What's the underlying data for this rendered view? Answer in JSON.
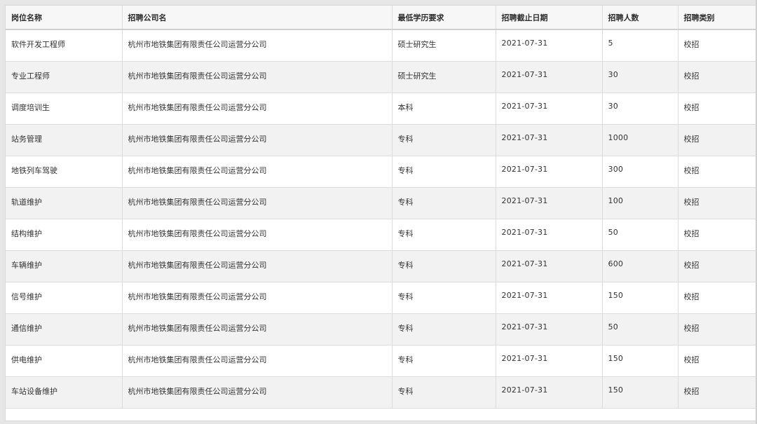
{
  "table": {
    "headers": [
      "岗位名称",
      "招聘公司名",
      "最低学历要求",
      "招聘截止日期",
      "招聘人数",
      "招聘类别"
    ],
    "rows": [
      [
        "软件开发工程师",
        "杭州市地铁集团有限责任公司运营分公司",
        "硕士研究生",
        "2021-07-31",
        "5",
        "校招"
      ],
      [
        "专业工程师",
        "杭州市地铁集团有限责任公司运营分公司",
        "硕士研究生",
        "2021-07-31",
        "30",
        "校招"
      ],
      [
        "调度培训生",
        "杭州市地铁集团有限责任公司运营分公司",
        "本科",
        "2021-07-31",
        "30",
        "校招"
      ],
      [
        "站务管理",
        "杭州市地铁集团有限责任公司运营分公司",
        "专科",
        "2021-07-31",
        "1000",
        "校招"
      ],
      [
        "地铁列车驾驶",
        "杭州市地铁集团有限责任公司运营分公司",
        "专科",
        "2021-07-31",
        "300",
        "校招"
      ],
      [
        "轨道维护",
        "杭州市地铁集团有限责任公司运营分公司",
        "专科",
        "2021-07-31",
        "100",
        "校招"
      ],
      [
        "结构维护",
        "杭州市地铁集团有限责任公司运营分公司",
        "专科",
        "2021-07-31",
        "50",
        "校招"
      ],
      [
        "车辆维护",
        "杭州市地铁集团有限责任公司运营分公司",
        "专科",
        "2021-07-31",
        "600",
        "校招"
      ],
      [
        "信号维护",
        "杭州市地铁集团有限责任公司运营分公司",
        "专科",
        "2021-07-31",
        "150",
        "校招"
      ],
      [
        "通信维护",
        "杭州市地铁集团有限责任公司运营分公司",
        "专科",
        "2021-07-31",
        "50",
        "校招"
      ],
      [
        "供电维护",
        "杭州市地铁集团有限责任公司运营分公司",
        "专科",
        "2021-07-31",
        "150",
        "校招"
      ],
      [
        "车站设备维护",
        "杭州市地铁集团有限责任公司运营分公司",
        "专科",
        "2021-07-31",
        "150",
        "校招"
      ]
    ]
  }
}
